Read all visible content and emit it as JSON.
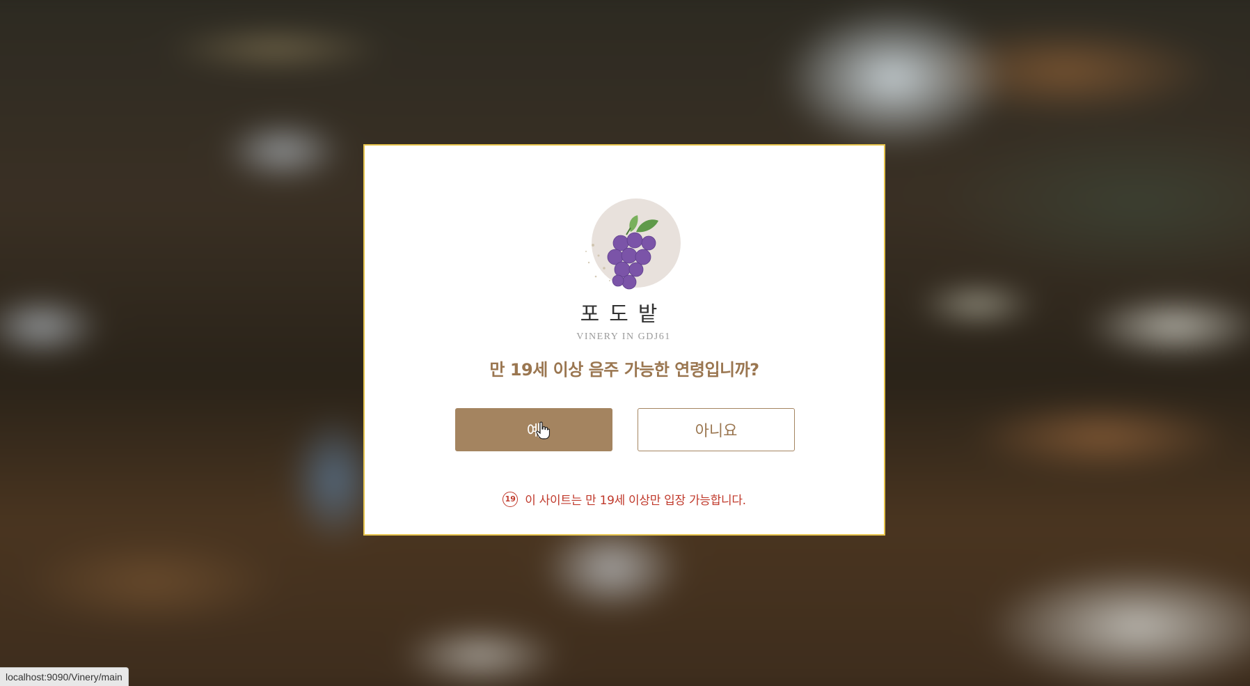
{
  "modal": {
    "logo": {
      "name_ko": "포도밭",
      "subtitle": "VINERY IN GDJ61"
    },
    "question": "만 19세 이상 음주 가능한 연령입니까?",
    "yes_button": "예",
    "no_button": "아니요",
    "age_badge": "19",
    "notice": "이 사이트는 만 19세 이상만 입장 가능합니다."
  },
  "status_bar": {
    "url": "localhost:9090/Vinery/main"
  },
  "colors": {
    "accent": "#a48460",
    "text_brown": "#9a7650",
    "warning": "#c0392b",
    "modal_border": "#e6c34b",
    "grape": "#7b54a8",
    "leaf": "#5f9a4a"
  }
}
